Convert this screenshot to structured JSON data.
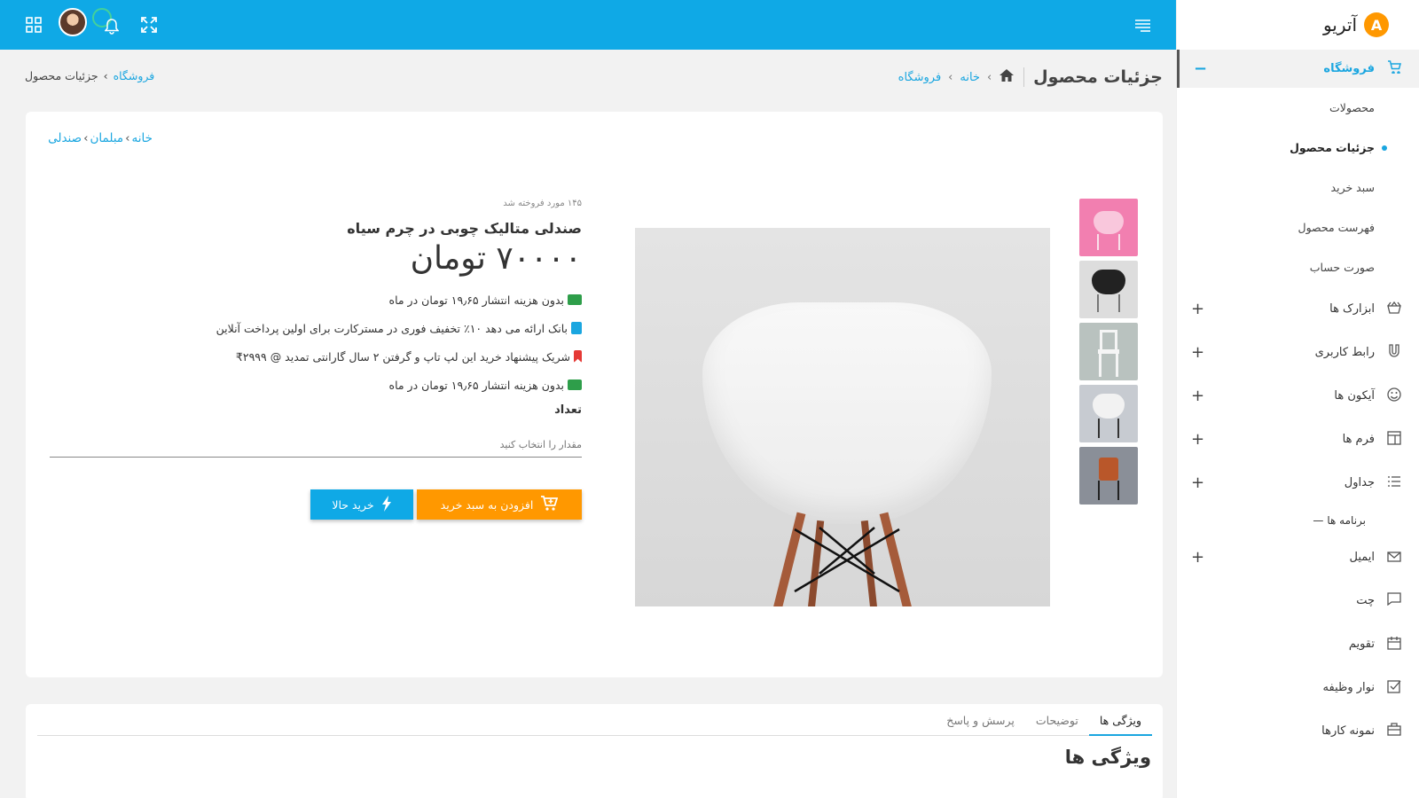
{
  "brand": {
    "logo_letter": "A",
    "name": "آتریو"
  },
  "topbar": {
    "color": "#0fa9e6"
  },
  "sidebar": {
    "shop": {
      "label": "فروشگاه",
      "toggle": "−"
    },
    "shop_items": [
      {
        "label": "محصولات"
      },
      {
        "label": "جزئیات محصول"
      },
      {
        "label": "سبد خرید"
      },
      {
        "label": "فهرست محصول"
      },
      {
        "label": "صورت حساب"
      }
    ],
    "groups": [
      {
        "label": "ابزارک ها",
        "toggle": "+",
        "icon": "basket-icon"
      },
      {
        "label": "رابط کاربری",
        "toggle": "+",
        "icon": "magnet-icon"
      },
      {
        "label": "آیکون ها",
        "toggle": "+",
        "icon": "smile-icon"
      },
      {
        "label": "فرم ها",
        "toggle": "+",
        "icon": "layout-icon"
      },
      {
        "label": "جداول",
        "toggle": "+",
        "icon": "list-icon"
      }
    ],
    "apps_heading": "برنامه ها",
    "apps": [
      {
        "label": "ایمیل",
        "toggle": "+",
        "icon": "mail-icon"
      },
      {
        "label": "چت",
        "toggle": "",
        "icon": "chat-icon"
      },
      {
        "label": "تقویم",
        "toggle": "",
        "icon": "calendar-icon"
      },
      {
        "label": "نوار وظیفه",
        "toggle": "",
        "icon": "checkbox-icon"
      },
      {
        "label": "نمونه کارها",
        "toggle": "",
        "icon": "briefcase-icon"
      }
    ]
  },
  "page_header": {
    "title": "جزئیات محصول",
    "crumb": {
      "home": "خانه",
      "shop": "فروشگاه",
      "current": "جزئیات محصول",
      "sep": "›"
    }
  },
  "product": {
    "breadcrumb": {
      "home": "خانه",
      "furniture": "مبلمان",
      "chair": "صندلی",
      "sep": "›"
    },
    "sold": "۱۴۵ مورد فروخته شد",
    "title": "صندلی متالیک چوبی در چرم سیاه",
    "price": "۷۰۰۰۰ تومان",
    "features": [
      {
        "text": "بدون هزینه انتشار ۱۹٫۶۵ تومان در ماه",
        "color": "#2e9e4a"
      },
      {
        "text": "بانک ارائه می دهد ۱۰٪ تخفیف فوری در مسترکارت برای اولین پرداخت آنلاین",
        "color": "#1aa6e0"
      },
      {
        "text": "شریک پیشنهاد خرید این لپ تاپ و گرفتن ۲ سال گارانتی تمدید @ ۲۹۹۹₹",
        "color": "#e53935"
      },
      {
        "text": "بدون هزینه انتشار ۱۹٫۶۵ تومان در ماه",
        "color": "#2e9e4a"
      }
    ],
    "qty_label": "تعداد",
    "qty_placeholder": "مقدار را انتخاب کنید",
    "add_to_cart": "افزودن به سبد خرید",
    "buy_now": "خرید حالا",
    "colors": {
      "cart": "#ff9800",
      "buy": "#0fa9e6"
    }
  },
  "tabs": {
    "items": [
      {
        "label": "ویژگی ها"
      },
      {
        "label": "توضیحات"
      },
      {
        "label": "پرسش و پاسخ"
      }
    ],
    "section_title": "ویژگی ها"
  }
}
